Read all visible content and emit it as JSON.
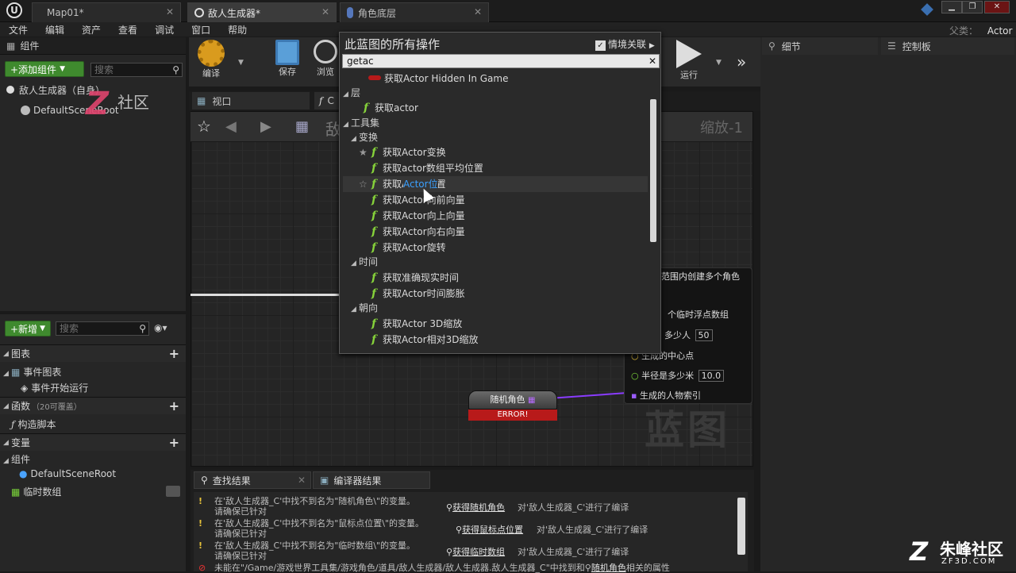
{
  "tabs": [
    {
      "label": "Map01*"
    },
    {
      "label": "敌人生成器*"
    },
    {
      "label": "角色底层"
    }
  ],
  "parent_class": {
    "label": "父类：",
    "value": "Actor"
  },
  "menu": [
    "文件",
    "编辑",
    "资产",
    "查看",
    "调试",
    "窗口",
    "帮助"
  ],
  "components": {
    "title": "组件",
    "add_button": "+添加组件",
    "search_placeholder": "搜索",
    "self_item": "敌人生成器（自身）",
    "root_item": "DefaultSceneRoot"
  },
  "toolbar": {
    "compile": "编译",
    "save": "保存",
    "browse": "浏览",
    "run": "运行"
  },
  "subtabs": {
    "viewport": "视口",
    "construction": "C"
  },
  "graph": {
    "zoom": "缩放-1",
    "title_partial": "敌",
    "watermark": "蓝图"
  },
  "popup": {
    "title": "此蓝图的所有操作",
    "context_label": "情境关联",
    "search_value": "getac",
    "items": [
      {
        "type": "event",
        "label": "获取Actor Hidden In Game"
      },
      {
        "type": "cat",
        "label": "层"
      },
      {
        "type": "fn",
        "label": "获取actor"
      },
      {
        "type": "cat",
        "label": "工具集"
      },
      {
        "type": "cat",
        "label": "变换"
      },
      {
        "type": "fn",
        "label": "获取Actor变换"
      },
      {
        "type": "fn",
        "label": "获取actor数组平均位置"
      },
      {
        "type": "fn",
        "label": "获取Actor位置"
      },
      {
        "type": "fn",
        "label": "获取Actor向前向量"
      },
      {
        "type": "fn",
        "label": "获取Actor向上向量"
      },
      {
        "type": "fn",
        "label": "获取Actor向右向量"
      },
      {
        "type": "fn",
        "label": "获取Actor旋转"
      },
      {
        "type": "cat",
        "label": "时间"
      },
      {
        "type": "fn",
        "label": "获取准确现实时间"
      },
      {
        "type": "fn",
        "label": "获取Actor时间膨胀"
      },
      {
        "type": "cat",
        "label": "朝向"
      },
      {
        "type": "fn",
        "label": "获取Actor 3D缩放"
      },
      {
        "type": "fn",
        "label": "获取Actor相对3D缩放"
      }
    ]
  },
  "node_right": {
    "title": "范围内创建多个角色",
    "pins": [
      "个临时浮点数组",
      "多少人",
      "生成的中心点",
      "半径是多少米",
      "生成的人物索引"
    ],
    "count_value": "50",
    "radius_value": "10.0"
  },
  "node_center": {
    "title": "随机角色",
    "error": "ERROR!"
  },
  "my_blueprint": {
    "new_button": "+新增",
    "search_placeholder": "搜索",
    "graphs_label": "图表",
    "event_graph": "事件图表",
    "begin_play": "事件开始运行",
    "functions_label": "函数",
    "functions_note": "（20可覆盖）",
    "construction_script": "构造脚本",
    "variables_label": "变量",
    "components_label": "组件",
    "default_root": "DefaultSceneRoot",
    "temp_array": "临时数组"
  },
  "annotation": {
    "text": "社区"
  },
  "right_panels": {
    "details": "细节",
    "console": "控制板"
  },
  "bottom": {
    "find_results": "查找结果",
    "compiler_results": "编译器结果",
    "messages": [
      {
        "line1": "在'敌人生成器_C'中找不到名为\"随机角色\\\"的变量。",
        "line2": "请确保已针对",
        "link": "获得随机角色",
        "tail": "对'敌人生成器_C'进行了编译"
      },
      {
        "line1": "在'敌人生成器_C'中找不到名为\"鼠标点位置\\\"的变量。",
        "line2": "请确保已针对",
        "link": "获得鼠标点位置",
        "tail": "对'敌人生成器_C'进行了编译"
      },
      {
        "line1": "在'敌人生成器_C'中找不到名为\"临时数组\\\"的变量。",
        "line2": "请确保已针对",
        "link": "获得临时数组",
        "tail": "对'敌人生成器_C'进行了编译"
      }
    ],
    "error_line": "未能在\"/Game/游戏世界工具集/游戏角色/道具/敌人生成器/敌人生成器.敌人生成器_C\"中找到和",
    "error_link": "随机角色",
    "error_tail": "相关的属性"
  },
  "brand": {
    "name": "朱峰社区",
    "domain": "ZF3D.COM"
  },
  "colors": {
    "accent_green": "#3f8a2e",
    "function_green": "#86d33a",
    "error_red": "#b81a1a",
    "highlight_blue": "#3aa0ff"
  }
}
